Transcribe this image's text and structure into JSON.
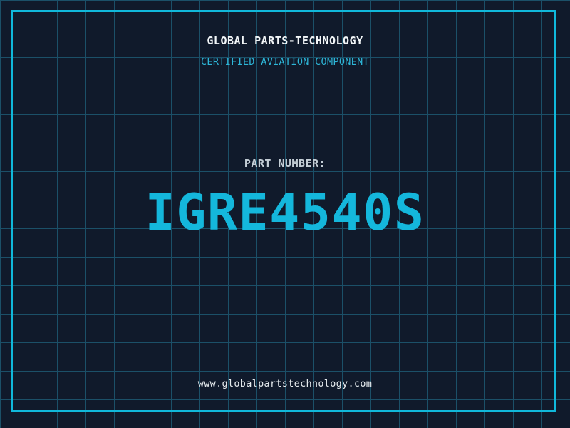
{
  "header": {
    "company_name": "GLOBAL PARTS-TECHNOLOGY",
    "tagline": "CERTIFIED AVIATION COMPONENT"
  },
  "part": {
    "label": "PART NUMBER:",
    "number": "IGRE4540S"
  },
  "footer": {
    "website": "www.globalpartstechnology.com"
  },
  "colors": {
    "background": "#101a2b",
    "grid_line": "#1b5068",
    "frame_border": "#10b8db",
    "company_text": "#f2f6f8",
    "tagline_text": "#2db6d8",
    "label_text": "#c4ced6",
    "part_number_text": "#14b7dc",
    "website_text": "#e6ebee"
  }
}
